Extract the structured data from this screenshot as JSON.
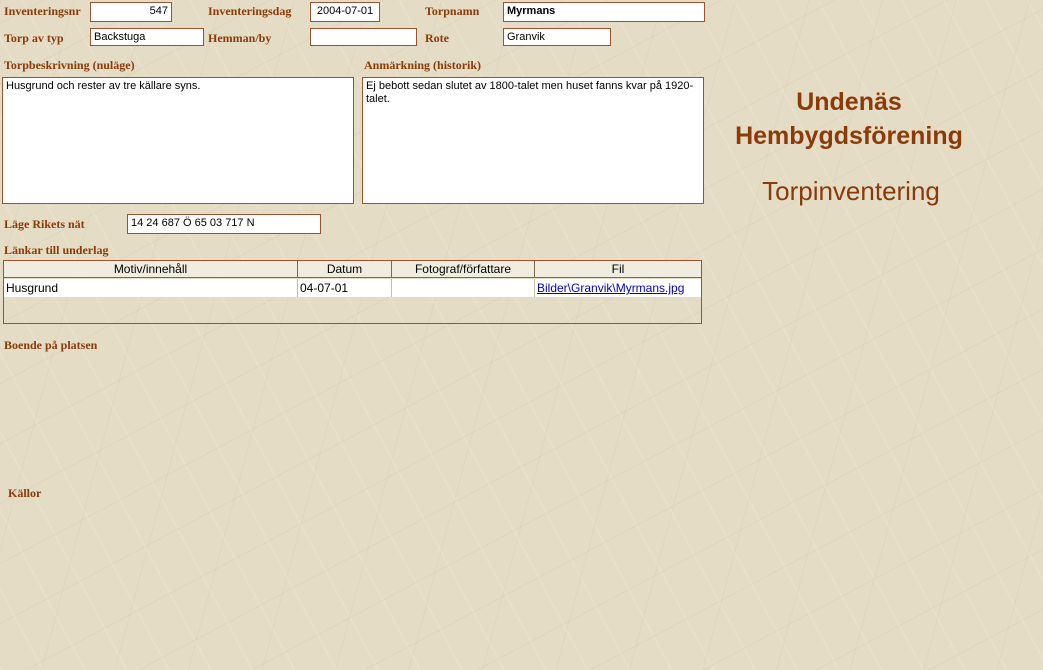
{
  "labels": {
    "inventeringsnr": "Inventeringsnr",
    "inventeringsdag": "Inventeringsdag",
    "torpnamn": "Torpnamn",
    "torp_av_typ": "Torp av typ",
    "hemman_by": "Hemman/by",
    "rote": "Rote",
    "torpbeskrivning": "Torpbeskrivning (nuläge)",
    "anmarkning": "Anmärkning (historik)",
    "lage": "Läge Rikets nät",
    "lankar": "Länkar till underlag",
    "boende": "Boende på platsen",
    "kallor": "Källor"
  },
  "fields": {
    "inventeringsnr": "547",
    "inventeringsdag": "2004-07-01",
    "torpnamn": "Myrmans",
    "torp_av_typ": "Backstuga",
    "hemman_by": "",
    "rote": "Granvik",
    "torpbeskrivning": "Husgrund och rester av tre källare syns.",
    "anmarkning": "Ej bebott sedan slutet av 1800-talet men huset fanns kvar på 1920-talet.",
    "lage": "14 24 687 Ö  65 03 717 N"
  },
  "header": {
    "org_line1": "Undenäs",
    "org_line2": "Hembygdsförening",
    "subtitle": "Torpinventering"
  },
  "links_table": {
    "columns": [
      "Motiv/innehåll",
      "Datum",
      "Fotograf/författare",
      "Fil"
    ],
    "rows": [
      {
        "motiv": "Husgrund",
        "datum": "04-07-01",
        "fotograf": "",
        "fil": "Bilder\\Granvik\\Myrmans.jpg"
      }
    ]
  },
  "colors": {
    "label": "#8b3a0a",
    "border": "#a0522d",
    "link": "#0000cc"
  }
}
